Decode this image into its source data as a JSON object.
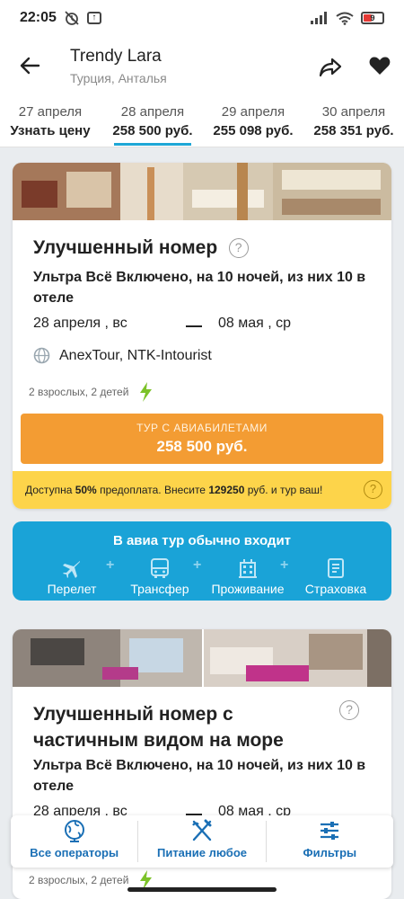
{
  "status_bar": {
    "time": "22:05",
    "battery_level": "9"
  },
  "header": {
    "hotel_name": "Trendy Lara",
    "location": "Турция, Анталья"
  },
  "date_tabs": [
    {
      "date": "27 апреля",
      "price": "Узнать цену",
      "active": false
    },
    {
      "date": "28 апреля",
      "price": "258 500 руб.",
      "active": true
    },
    {
      "date": "29 апреля",
      "price": "255 098 руб.",
      "active": false
    },
    {
      "date": "30 апреля",
      "price": "258 351 руб.",
      "active": false
    }
  ],
  "offers": [
    {
      "room_title": "Улучшенный номер",
      "meal": "Ультра Всё Включено, на 10 ночей, из них 10 в отеле",
      "date_from": "28 апреля , вс",
      "date_to": "08 мая , ср",
      "operators": "AnexTour, NTK-Intourist",
      "pax": "2 взрослых, 2 детей",
      "buy_label": "ТУР С АВИАБИЛЕТАМИ",
      "buy_price": "258 500 руб.",
      "prepay": {
        "prefix": "Доступна ",
        "percent": "50%",
        "middle": " предоплата. Внесите ",
        "amount": "129250",
        "suffix": " руб. и тур ваш!"
      }
    },
    {
      "room_title": "Улучшенный номер с частичным видом на море",
      "meal": "Ультра Всё Включено, на 10 ночей, из них 10 в отеле",
      "date_from": "28 апреля , вс",
      "date_to": "08 мая , ср",
      "pax": "2 взрослых, 2 детей"
    }
  ],
  "included": {
    "title": "В авиа тур обычно входит",
    "items": [
      {
        "label": "Перелет",
        "icon": "plane-icon"
      },
      {
        "label": "Трансфер",
        "icon": "bus-icon"
      },
      {
        "label": "Проживание",
        "icon": "hotel-icon"
      },
      {
        "label": "Страховка",
        "icon": "insurance-icon"
      }
    ]
  },
  "bottom_nav": [
    {
      "label": "Все операторы",
      "icon": "globe-icon"
    },
    {
      "label": "Питание любое",
      "icon": "cutlery-icon"
    },
    {
      "label": "Фильтры",
      "icon": "filters-icon"
    }
  ],
  "colors": {
    "accent": "#1aa3d7",
    "buy_button": "#f39c33",
    "prepay_bg": "#fdd44a",
    "nav_text": "#1a6fb5",
    "bolt": "#7cc229"
  }
}
